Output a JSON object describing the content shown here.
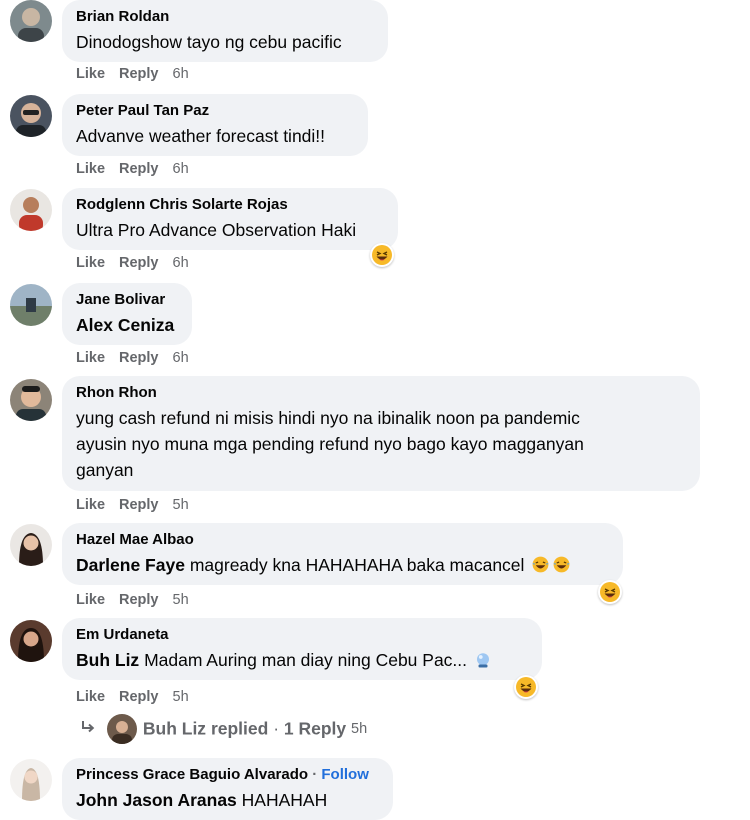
{
  "comments": [
    {
      "author": "Brian Roldan",
      "text": "Dinodogshow tayo ng cebu pacific",
      "like": "Like",
      "reply": "Reply",
      "time": "6h"
    },
    {
      "author": "Peter Paul Tan Paz",
      "text": "Advanve weather forecast tindi!!",
      "like": "Like",
      "reply": "Reply",
      "time": "6h"
    },
    {
      "author": "Rodglenn Chris Solarte Rojas",
      "text": "Ultra Pro Advance Observation Haki",
      "like": "Like",
      "reply": "Reply",
      "time": "6h",
      "reaction": "laughing-emoji"
    },
    {
      "author": "Jane Bolivar",
      "mention": "Alex Ceniza",
      "like": "Like",
      "reply": "Reply",
      "time": "6h"
    },
    {
      "author": "Rhon Rhon",
      "text_lines": [
        "yung cash refund ni misis hindi nyo na ibinalik noon pa pandemic",
        "ayusin nyo muna mga pending refund nyo bago kayo magganyan",
        "ganyan"
      ],
      "like": "Like",
      "reply": "Reply",
      "time": "5h"
    },
    {
      "author": "Hazel Mae Albao",
      "mention": "Darlene Faye",
      "text": "magready kna HAHAHAHA baka macancel",
      "like": "Like",
      "reply": "Reply",
      "time": "5h",
      "reaction": "laughing-emoji"
    },
    {
      "author": "Em Urdaneta",
      "mention": "Buh Liz",
      "text": "Madam Auring man diay ning Cebu Pac...",
      "like": "Like",
      "reply": "Reply",
      "time": "5h",
      "reaction": "laughing-emoji"
    },
    {
      "author": "Princess Grace Baguio Alvarado",
      "separator": "·",
      "follow": "Follow",
      "mention": "John Jason Aranas",
      "text": "HAHAHAH"
    }
  ],
  "replies_row": {
    "name": "Buh Liz",
    "replied": "replied",
    "separator": "·",
    "count": "1 Reply",
    "time": "5h"
  }
}
